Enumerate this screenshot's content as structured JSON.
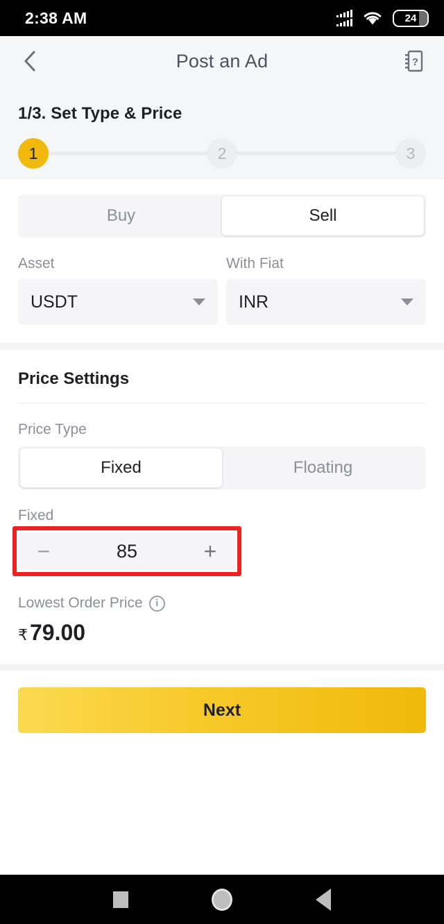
{
  "status_bar": {
    "time": "2:38 AM",
    "signal_icon": "signal-bars-icon",
    "wifi_icon": "wifi-icon",
    "battery_level": "24"
  },
  "header": {
    "back_icon": "chevron-left-icon",
    "title": "Post an Ad",
    "help_icon": "help-manual-icon"
  },
  "stage": {
    "title": "1/3. Set Type & Price",
    "steps": [
      {
        "label": "1",
        "active": true
      },
      {
        "label": "2",
        "active": false
      },
      {
        "label": "3",
        "active": false
      }
    ]
  },
  "trade_type": {
    "options": [
      {
        "label": "Buy",
        "selected": false
      },
      {
        "label": "Sell",
        "selected": true
      }
    ]
  },
  "asset": {
    "label": "Asset",
    "value": "USDT",
    "caret_icon": "chevron-down-icon"
  },
  "fiat": {
    "label": "With Fiat",
    "value": "INR",
    "caret_icon": "chevron-down-icon"
  },
  "price_settings": {
    "section_title": "Price Settings",
    "price_type_label": "Price Type",
    "price_type_options": [
      {
        "label": "Fixed",
        "selected": true
      },
      {
        "label": "Floating",
        "selected": false
      }
    ],
    "fixed_label": "Fixed",
    "fixed_value": "85",
    "minus_label": "−",
    "plus_label": "+",
    "lowest_order_price_label": "Lowest Order Price",
    "info_icon": "info-icon",
    "info_glyph": "i",
    "lowest_order_currency": "₹",
    "lowest_order_price_value": "79.00"
  },
  "footer": {
    "next_label": "Next"
  },
  "nav_bar": {
    "recents_icon": "square-recents-icon",
    "home_icon": "circle-home-icon",
    "back_icon": "triangle-back-icon"
  },
  "annotation": {
    "highlight_target": "fixed-price-stepper",
    "highlight_color": "#ee2222"
  },
  "colors": {
    "accent": "#f0b90b",
    "page_bg": "#f5f6f7",
    "card_bg": "#ffffff",
    "muted_text": "#8b8f99",
    "primary_text": "#1e2026"
  }
}
